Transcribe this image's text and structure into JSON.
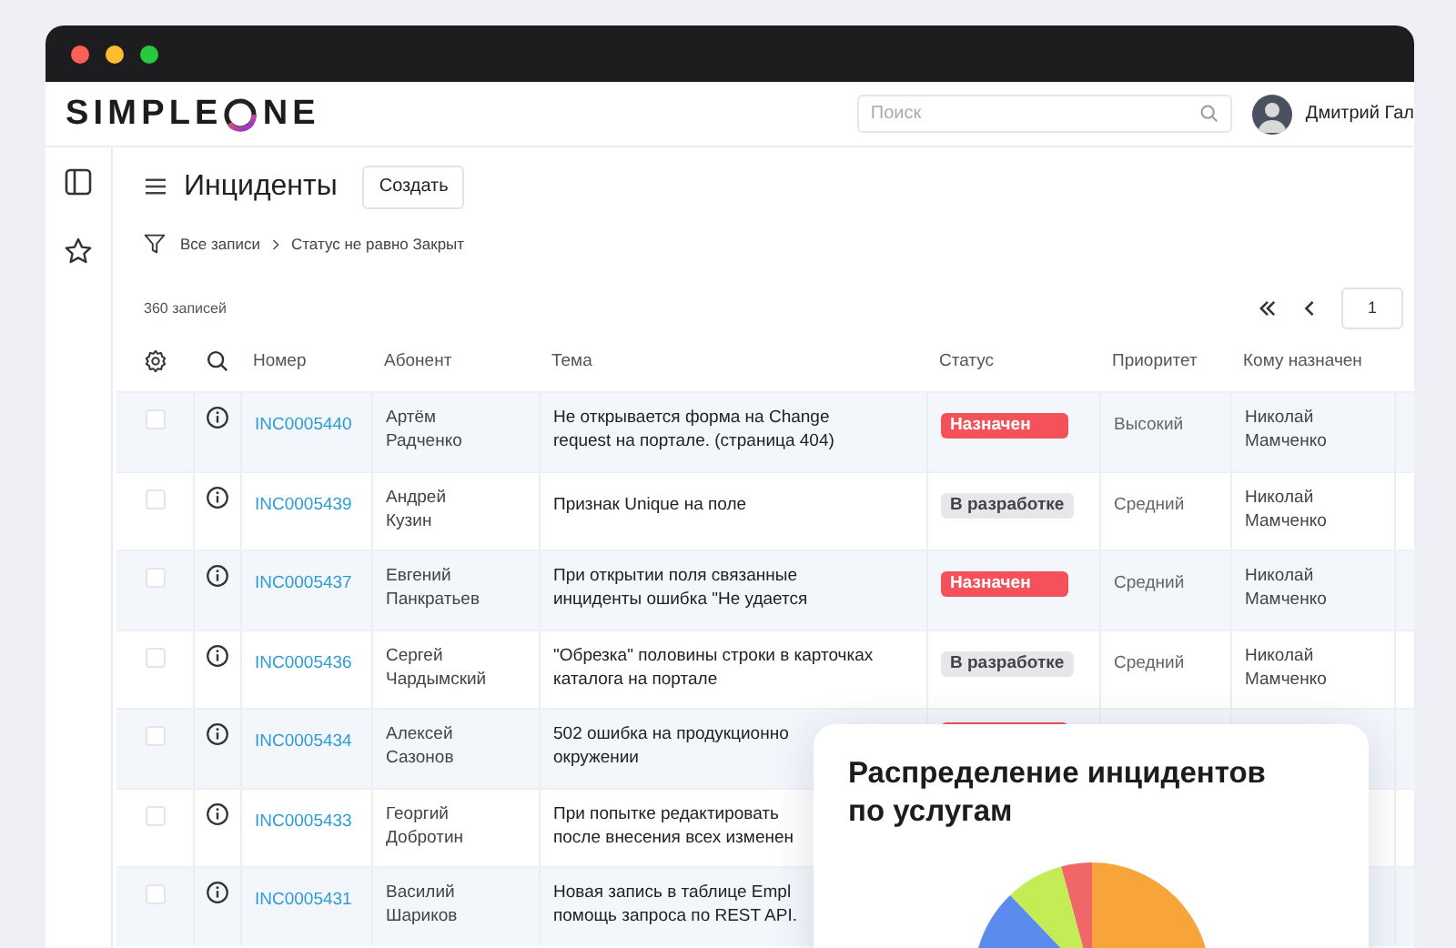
{
  "logo": {
    "before": "SIMPLE",
    "after": "NE"
  },
  "search": {
    "placeholder": "Поиск"
  },
  "user": {
    "name": "Дмитрий Гал"
  },
  "page": {
    "title": "Инциденты",
    "create_button": "Создать"
  },
  "filter": {
    "items": [
      "Все записи",
      "Статус не равно Закрыт"
    ]
  },
  "count": "360 записей",
  "pagination": {
    "page": "1"
  },
  "table": {
    "columns": [
      "Номер",
      "Абонент",
      "Тема",
      "Статус",
      "Приоритет",
      "Кому назначен"
    ],
    "rows": [
      {
        "checked": false,
        "number": "INC0005440",
        "subscriber": "Артём\nРадченко",
        "subject": "Не открывается форма на Change\nrequest на портале. (страница 404)",
        "status": {
          "kind": "assigned",
          "label": "Назначен"
        },
        "priority": "Высокий",
        "assignee": "Николай\nМамченко"
      },
      {
        "checked": false,
        "number": "INC0005439",
        "subscriber": "Андрей\nКузин",
        "subject": "Признак Unique на поле",
        "status": {
          "kind": "development",
          "label": "В разработке"
        },
        "priority": "Средний",
        "assignee": "Николай\nМамченко"
      },
      {
        "checked": false,
        "number": "INC0005437",
        "subscriber": "Евгений\nПанкратьев",
        "subject": "При открытии поля связанные\nинциденты ошибка \"Не удается",
        "status": {
          "kind": "assigned",
          "label": "Назначен"
        },
        "priority": "Средний",
        "assignee": "Николай\nМамченко"
      },
      {
        "checked": false,
        "number": "INC0005436",
        "subscriber": "Сергей\nЧардымский",
        "subject": "\"Обрезка\" половины строки в карточках\nкаталога на портале",
        "status": {
          "kind": "development",
          "label": "В разработке"
        },
        "priority": "Средний",
        "assignee": "Николай\nМамченко"
      },
      {
        "checked": false,
        "number": "INC0005434",
        "subscriber": "Алексей\nСазонов",
        "subject": "502 ошибка на продукционно\nокружении",
        "status": {
          "kind": "assigned"
        }
      },
      {
        "checked": false,
        "number": "INC0005433",
        "subscriber": "Георгий\nДобротин",
        "subject": "При попытке редактировать\nпосле внесения всех изменен"
      },
      {
        "checked": false,
        "number": "INC0005431",
        "subscriber": "Василий\nШариков",
        "subject": "Новая запись в таблице Empl\nпомощь запроса по REST API."
      }
    ]
  },
  "chart_card": {
    "title": "Распределение инцидентов по услугам"
  }
}
